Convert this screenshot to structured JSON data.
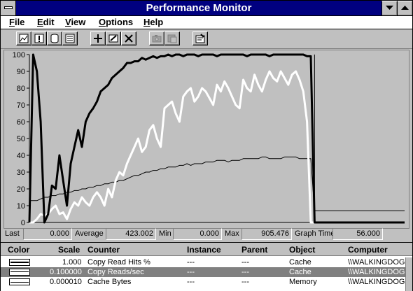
{
  "window": {
    "title": "Performance Monitor"
  },
  "menu": [
    {
      "first": "F",
      "rest": "ile"
    },
    {
      "first": "E",
      "rest": "dit"
    },
    {
      "first": "V",
      "rest": "iew"
    },
    {
      "first": "O",
      "rest": "ptions"
    },
    {
      "first": "H",
      "rest": "elp"
    }
  ],
  "chart_data": {
    "type": "line",
    "ylim": [
      0,
      100
    ],
    "yticks": [
      "100",
      "90",
      "80",
      "70",
      "60",
      "50",
      "40",
      "30",
      "20",
      "10",
      "0"
    ],
    "grid": false,
    "x": [
      0,
      1,
      2,
      3,
      4,
      5,
      6,
      7,
      8,
      9,
      10,
      11,
      12,
      13,
      14,
      15,
      16,
      17,
      18,
      19,
      20,
      21,
      22,
      23,
      24,
      25,
      26,
      27,
      28,
      29,
      30,
      31,
      32,
      33,
      34,
      35,
      36,
      37,
      38,
      39,
      40,
      41,
      42,
      43,
      44,
      45,
      46,
      47,
      48,
      49,
      50,
      51,
      52,
      53,
      54,
      55,
      56,
      57,
      58,
      59,
      60,
      61,
      62,
      63,
      64,
      65,
      66,
      67,
      68,
      69,
      70,
      71,
      72,
      73,
      74,
      75,
      76,
      77,
      78,
      79,
      80,
      81,
      82,
      83,
      84,
      85,
      86,
      87,
      88,
      89,
      90,
      91,
      92,
      93,
      94,
      95,
      96,
      97,
      98,
      99,
      100
    ],
    "series": [
      {
        "name": "Copy Read Hits %",
        "color": "#000000",
        "values": [
          0,
          100,
          90,
          60,
          0,
          5,
          22,
          20,
          40,
          25,
          10,
          35,
          45,
          55,
          45,
          60,
          65,
          68,
          72,
          78,
          80,
          82,
          86,
          88,
          90,
          92,
          95,
          95,
          96,
          96,
          98,
          97,
          98,
          99,
          98,
          99,
          99,
          100,
          99,
          100,
          100,
          99,
          100,
          100,
          100,
          99,
          100,
          100,
          100,
          100,
          99,
          100,
          100,
          100,
          100,
          100,
          100,
          100,
          99,
          100,
          100,
          100,
          100,
          100,
          99,
          100,
          100,
          100,
          100,
          100,
          100,
          100,
          100,
          100,
          99,
          99,
          0,
          0,
          0,
          0,
          0,
          0,
          0,
          0,
          0,
          0,
          0,
          0,
          0,
          0,
          0,
          0,
          0,
          0,
          0,
          0,
          0,
          0,
          0,
          0,
          0
        ]
      },
      {
        "name": "Copy Reads/sec",
        "color": "#ffffff",
        "values": [
          0,
          0,
          2,
          5,
          4,
          5,
          8,
          10,
          5,
          6,
          2,
          8,
          12,
          10,
          15,
          12,
          10,
          15,
          18,
          15,
          10,
          20,
          15,
          25,
          30,
          28,
          35,
          40,
          45,
          50,
          42,
          45,
          55,
          58,
          50,
          45,
          68,
          70,
          72,
          65,
          60,
          75,
          78,
          80,
          72,
          75,
          80,
          78,
          74,
          70,
          82,
          78,
          84,
          80,
          75,
          70,
          68,
          85,
          80,
          78,
          88,
          82,
          78,
          85,
          90,
          86,
          84,
          90,
          86,
          82,
          88,
          90,
          85,
          78,
          60,
          0,
          0,
          0,
          0,
          0,
          0,
          0,
          0,
          0,
          0,
          0,
          0,
          0,
          0,
          0,
          0,
          0,
          0,
          0,
          0,
          0,
          0,
          0,
          0,
          0,
          0
        ]
      },
      {
        "name": "Cache Bytes",
        "color": "#000000",
        "values": [
          13,
          13,
          13,
          14,
          15,
          15,
          16,
          16,
          17,
          17,
          18,
          18,
          19,
          19,
          20,
          20,
          21,
          21,
          22,
          22,
          23,
          23,
          24,
          24,
          25,
          25,
          26,
          27,
          28,
          28,
          29,
          30,
          30,
          31,
          31,
          32,
          32,
          33,
          33,
          33,
          34,
          34,
          35,
          34,
          35,
          35,
          35,
          36,
          36,
          36,
          37,
          37,
          37,
          36,
          37,
          37,
          37,
          38,
          38,
          38,
          38,
          38,
          39,
          39,
          38,
          38,
          38,
          38,
          39,
          39,
          39,
          39,
          38,
          38,
          38,
          38,
          7,
          7,
          7,
          7,
          7,
          7,
          7,
          7,
          7,
          7,
          7,
          7,
          7,
          7,
          7,
          7,
          7,
          7,
          7,
          7,
          7,
          7,
          7,
          7,
          7
        ]
      }
    ]
  },
  "stats": {
    "last_label": "Last",
    "last": "0.000",
    "average_label": "Average",
    "average": "423.002",
    "min_label": "Min",
    "min": "0.000",
    "max_label": "Max",
    "max": "905.476",
    "graph_time_label": "Graph Time",
    "graph_time": "56.000"
  },
  "legend": {
    "headers": {
      "color": "Color",
      "scale": "Scale",
      "counter": "Counter",
      "instance": "Instance",
      "parent": "Parent",
      "object": "Object",
      "computer": "Computer"
    },
    "rows": [
      {
        "swatch": "#000000",
        "scale": "1.000",
        "counter": "Copy Read Hits %",
        "instance": "---",
        "parent": "---",
        "object": "Cache",
        "computer": "\\\\WALKINGDOG"
      },
      {
        "swatch": "#ffffff",
        "scale": "0.100000",
        "counter": "Copy Reads/sec",
        "instance": "---",
        "parent": "---",
        "object": "Cache",
        "computer": "\\\\WALKINGDOG"
      },
      {
        "swatch": "#404040",
        "scale": "0.000010",
        "counter": "Cache Bytes",
        "instance": "---",
        "parent": "---",
        "object": "Memory",
        "computer": "\\\\WALKINGDOG"
      }
    ]
  }
}
